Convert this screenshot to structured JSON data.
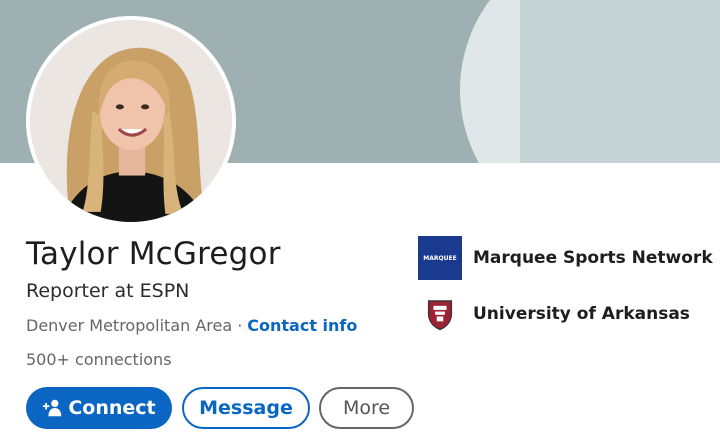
{
  "profile": {
    "name": "Taylor McGregor",
    "headline": "Reporter at ESPN",
    "location": "Denver Metropolitan Area",
    "separator": "·",
    "contact_label": "Contact info",
    "connections": "500+ connections"
  },
  "actions": {
    "connect_label": "Connect",
    "message_label": "Message",
    "more_label": "More"
  },
  "organizations": [
    {
      "name": "Marquee Sports Network",
      "logo_text": "MARQUEE",
      "icon": "marquee-sports-network-logo"
    },
    {
      "name": "University of Arkansas",
      "icon": "university-of-arkansas-logo"
    }
  ],
  "colors": {
    "accent": "#0a66c2",
    "banner": "#9fb0b3"
  }
}
